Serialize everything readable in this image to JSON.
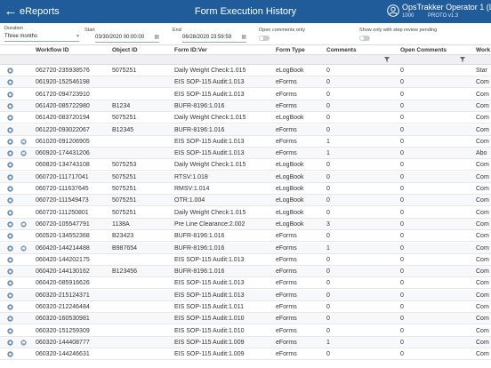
{
  "header": {
    "app_title": "eReports",
    "page_title": "Form Execution History",
    "user_name": "OpsTrakker Operator 1 (Local)",
    "user_badge": "1000",
    "user_env": "PROTO v1.3",
    "accent_color": "#1f5c99"
  },
  "filters": {
    "duration_label": "Duration",
    "duration_value": "Three months",
    "start_label": "Start",
    "start_value": "03/30/2020 00:00:00",
    "end_label": "End",
    "end_value": "06/28/2020 23:59:59",
    "open_comments_label": "Open comments only",
    "step_review_label": "Show only with step review pending"
  },
  "columns": [
    "Workflow ID",
    "Object ID",
    "Form ID:Ver",
    "Form Type",
    "Comments",
    "Open Comments",
    "Work"
  ],
  "rows": [
    {
      "wf": "062720-235938576",
      "obj": "5075251",
      "form": "Daily Weight Check:1.015",
      "type": "eLogBook",
      "com": "0",
      "open": "0",
      "work": "Star",
      "second_icon": false
    },
    {
      "wf": "061920-152546198",
      "obj": "",
      "form": "EIS SOP-115 Audit:1.013",
      "type": "eForms",
      "com": "0",
      "open": "0",
      "work": "Com",
      "second_icon": false
    },
    {
      "wf": "061720-094723910",
      "obj": "",
      "form": "EIS SOP-115 Audit:1.013",
      "type": "eForms",
      "com": "0",
      "open": "0",
      "work": "Com",
      "second_icon": false
    },
    {
      "wf": "061420-085722980",
      "obj": "B1234",
      "form": "BUFR-8196:1.016",
      "type": "eForms",
      "com": "0",
      "open": "0",
      "work": "Com",
      "second_icon": false
    },
    {
      "wf": "061420-083720194",
      "obj": "5075251",
      "form": "Daily Weight Check:1.015",
      "type": "eLogBook",
      "com": "0",
      "open": "0",
      "work": "Com",
      "second_icon": false
    },
    {
      "wf": "061220-093022067",
      "obj": "B12345",
      "form": "BUFR-8196:1.016",
      "type": "eForms",
      "com": "0",
      "open": "0",
      "work": "Com",
      "second_icon": false
    },
    {
      "wf": "061020-091206905",
      "obj": "",
      "form": "EIS SOP-115 Audit:1.013",
      "type": "eForms",
      "com": "1",
      "open": "0",
      "work": "Com",
      "second_icon": true
    },
    {
      "wf": "060920-174431206",
      "obj": "",
      "form": "EIS SOP-115 Audit:1.013",
      "type": "eForms",
      "com": "1",
      "open": "0",
      "work": "Abo",
      "second_icon": true
    },
    {
      "wf": "060820-134743108",
      "obj": "5075253",
      "form": "Daily Weight Check:1.015",
      "type": "eLogBook",
      "com": "0",
      "open": "0",
      "work": "Com",
      "second_icon": false
    },
    {
      "wf": "060720-111717041",
      "obj": "5075251",
      "form": "RTSV:1.018",
      "type": "eLogBook",
      "com": "0",
      "open": "0",
      "work": "Com",
      "second_icon": false
    },
    {
      "wf": "060720-111637645",
      "obj": "5075251",
      "form": "RMSV:1.014",
      "type": "eLogBook",
      "com": "0",
      "open": "0",
      "work": "Com",
      "second_icon": false
    },
    {
      "wf": "060720-111549473",
      "obj": "5075251",
      "form": "OTR:1.004",
      "type": "eLogBook",
      "com": "0",
      "open": "0",
      "work": "Com",
      "second_icon": false
    },
    {
      "wf": "060720-111250801",
      "obj": "5075251",
      "form": "Daily Weight Check:1.015",
      "type": "eLogBook",
      "com": "0",
      "open": "0",
      "work": "Com",
      "second_icon": false
    },
    {
      "wf": "060720-105547791",
      "obj": "1138A",
      "form": "Pre Line Clearance:2.002",
      "type": "eLogBook",
      "com": "3",
      "open": "0",
      "work": "Com",
      "second_icon": true
    },
    {
      "wf": "060520-134552368",
      "obj": "B23423",
      "form": "BUFR-8196:1.016",
      "type": "eForms",
      "com": "0",
      "open": "0",
      "work": "Com",
      "second_icon": false
    },
    {
      "wf": "060420-144214488",
      "obj": "B987654",
      "form": "BUFR-8196:1.016",
      "type": "eForms",
      "com": "1",
      "open": "0",
      "work": "Com",
      "second_icon": true
    },
    {
      "wf": "060420-144202175",
      "obj": "",
      "form": "EIS SOP-115 Audit:1.013",
      "type": "eForms",
      "com": "0",
      "open": "0",
      "work": "Com",
      "second_icon": false
    },
    {
      "wf": "060420-144130162",
      "obj": "B123456",
      "form": "BUFR-8196:1.016",
      "type": "eForms",
      "com": "0",
      "open": "0",
      "work": "Com",
      "second_icon": false
    },
    {
      "wf": "060420-085916626",
      "obj": "",
      "form": "EIS SOP-115 Audit:1.013",
      "type": "eForms",
      "com": "0",
      "open": "0",
      "work": "Com",
      "second_icon": false
    },
    {
      "wf": "060320-215124371",
      "obj": "",
      "form": "EIS SOP-115 Audit:1.013",
      "type": "eForms",
      "com": "0",
      "open": "0",
      "work": "Com",
      "second_icon": false
    },
    {
      "wf": "060320-212246484",
      "obj": "",
      "form": "EIS SOP-115 Audit:1.011",
      "type": "eForms",
      "com": "0",
      "open": "0",
      "work": "Com",
      "second_icon": false
    },
    {
      "wf": "060320-160530981",
      "obj": "",
      "form": "EIS SOP-115 Audit:1.010",
      "type": "eForms",
      "com": "0",
      "open": "0",
      "work": "Com",
      "second_icon": false
    },
    {
      "wf": "060320-151259309",
      "obj": "",
      "form": "EIS SOP-115 Audit:1.010",
      "type": "eForms",
      "com": "0",
      "open": "0",
      "work": "Com",
      "second_icon": false
    },
    {
      "wf": "060320-144408777",
      "obj": "",
      "form": "EIS SOP-115 Audit:1.009",
      "type": "eForms",
      "com": "1",
      "open": "0",
      "work": "Com",
      "second_icon": true
    },
    {
      "wf": "060320-144246631",
      "obj": "",
      "form": "EIS SOP-115 Audit:1.009",
      "type": "eForms",
      "com": "0",
      "open": "0",
      "work": "Com",
      "second_icon": false
    }
  ]
}
